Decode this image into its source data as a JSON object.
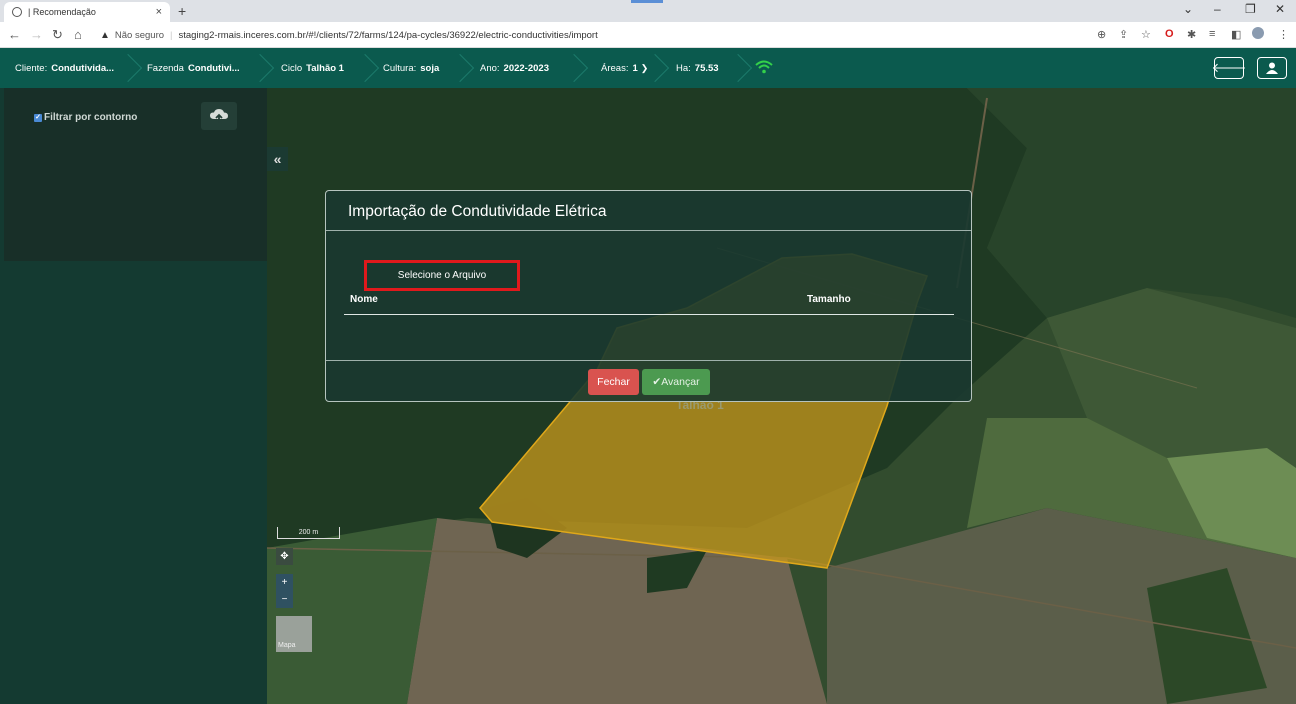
{
  "browser": {
    "tab_title": "| Recomendação",
    "close_glyph": "×",
    "newtab_glyph": "+",
    "security_label": "Não seguro",
    "url": "staging2-rmais.inceres.com.br/#!/clients/72/farms/124/pa-cycles/36922/electric-conductivities/import"
  },
  "header": {
    "cliente_label": "Cliente:",
    "cliente_value": "Condutivida...",
    "fazenda_label": "Fazenda",
    "fazenda_value": "Condutivi...",
    "ciclo_label": "Ciclo",
    "ciclo_value": "Talhão 1",
    "cultura_label": "Cultura:",
    "cultura_value": "soja",
    "ano_label": "Ano:",
    "ano_value": "2022-2023",
    "areas_label": "Áreas:",
    "areas_value": "1",
    "ha_label": "Ha:",
    "ha_value": "75.53"
  },
  "sidebar": {
    "filter_label": "Filtrar por contorno",
    "filter_checked": true,
    "collapse_glyph": "«"
  },
  "map": {
    "scale_label": "200 m",
    "zoom_in": "+",
    "zoom_out": "−",
    "pan_glyph": "✥",
    "layer_thumb_label": "Mapa",
    "field_label": "Talhão 1",
    "field_color": "#d9a11a"
  },
  "modal": {
    "title": "Importação de Condutividade Elétrica",
    "select_file_label": "Selecione o Arquivo",
    "col_name": "Nome",
    "col_size": "Tamanho",
    "close_label": "Fechar",
    "next_label": "Avançar",
    "next_icon": "✔"
  },
  "colors": {
    "header_bg": "#0b5a4e",
    "sidebar_bg": "#143a31",
    "highlight_border": "#e0191c",
    "danger": "#d9534f",
    "success": "#4c9a50"
  }
}
